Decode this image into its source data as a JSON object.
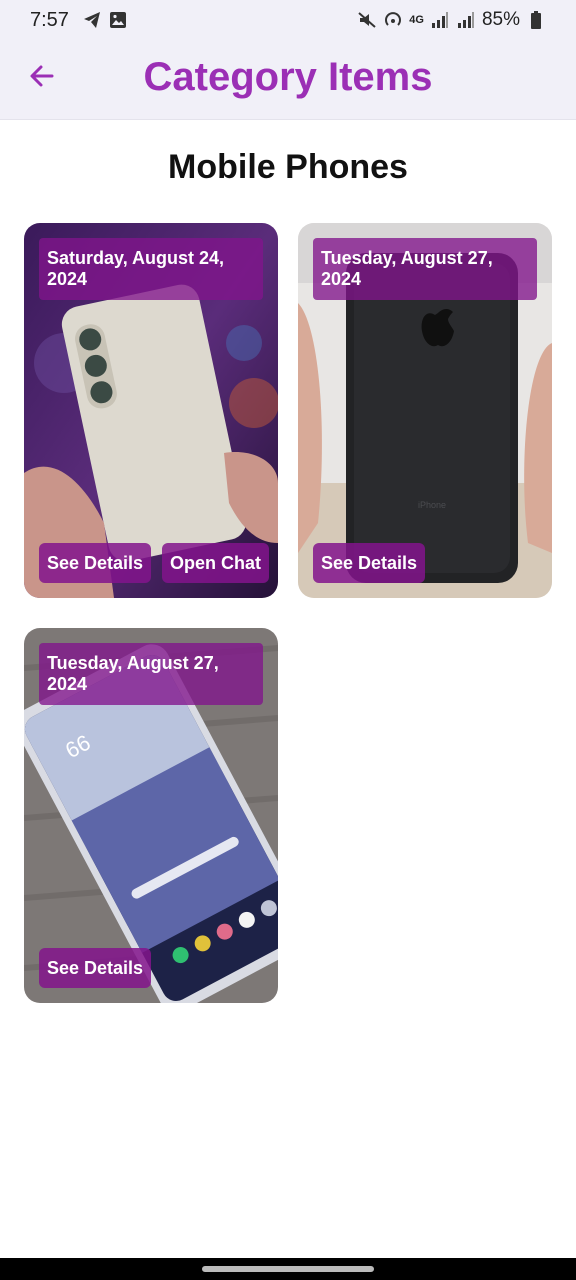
{
  "status_bar": {
    "time": "7:57",
    "network": "4G",
    "battery": "85%",
    "icons_left": [
      "telegram-icon",
      "image-icon"
    ],
    "icons_right": [
      "mute-icon",
      "hotspot-icon",
      "signal-icon",
      "signal-icon",
      "battery-icon"
    ]
  },
  "app_bar": {
    "title": "Category Items",
    "back_icon": "arrow-left-icon",
    "accent_color": "#9b2fb5"
  },
  "section": {
    "title": "Mobile Phones"
  },
  "items": [
    {
      "date": "Saturday, August 24, 2024",
      "details_label": "See Details",
      "chat_label": "Open Chat",
      "image": "white Samsung Galaxy phone held in hand"
    },
    {
      "date": "Tuesday, August 27, 2024",
      "details_label": "See Details",
      "image": "black iPhone held in hand"
    },
    {
      "date": "Tuesday, August 27, 2024",
      "details_label": "See Details",
      "image": "Samsung Galaxy Note on wooden table"
    }
  ],
  "colors": {
    "badge": "#82148c",
    "header_bg": "#f1f0f8"
  }
}
